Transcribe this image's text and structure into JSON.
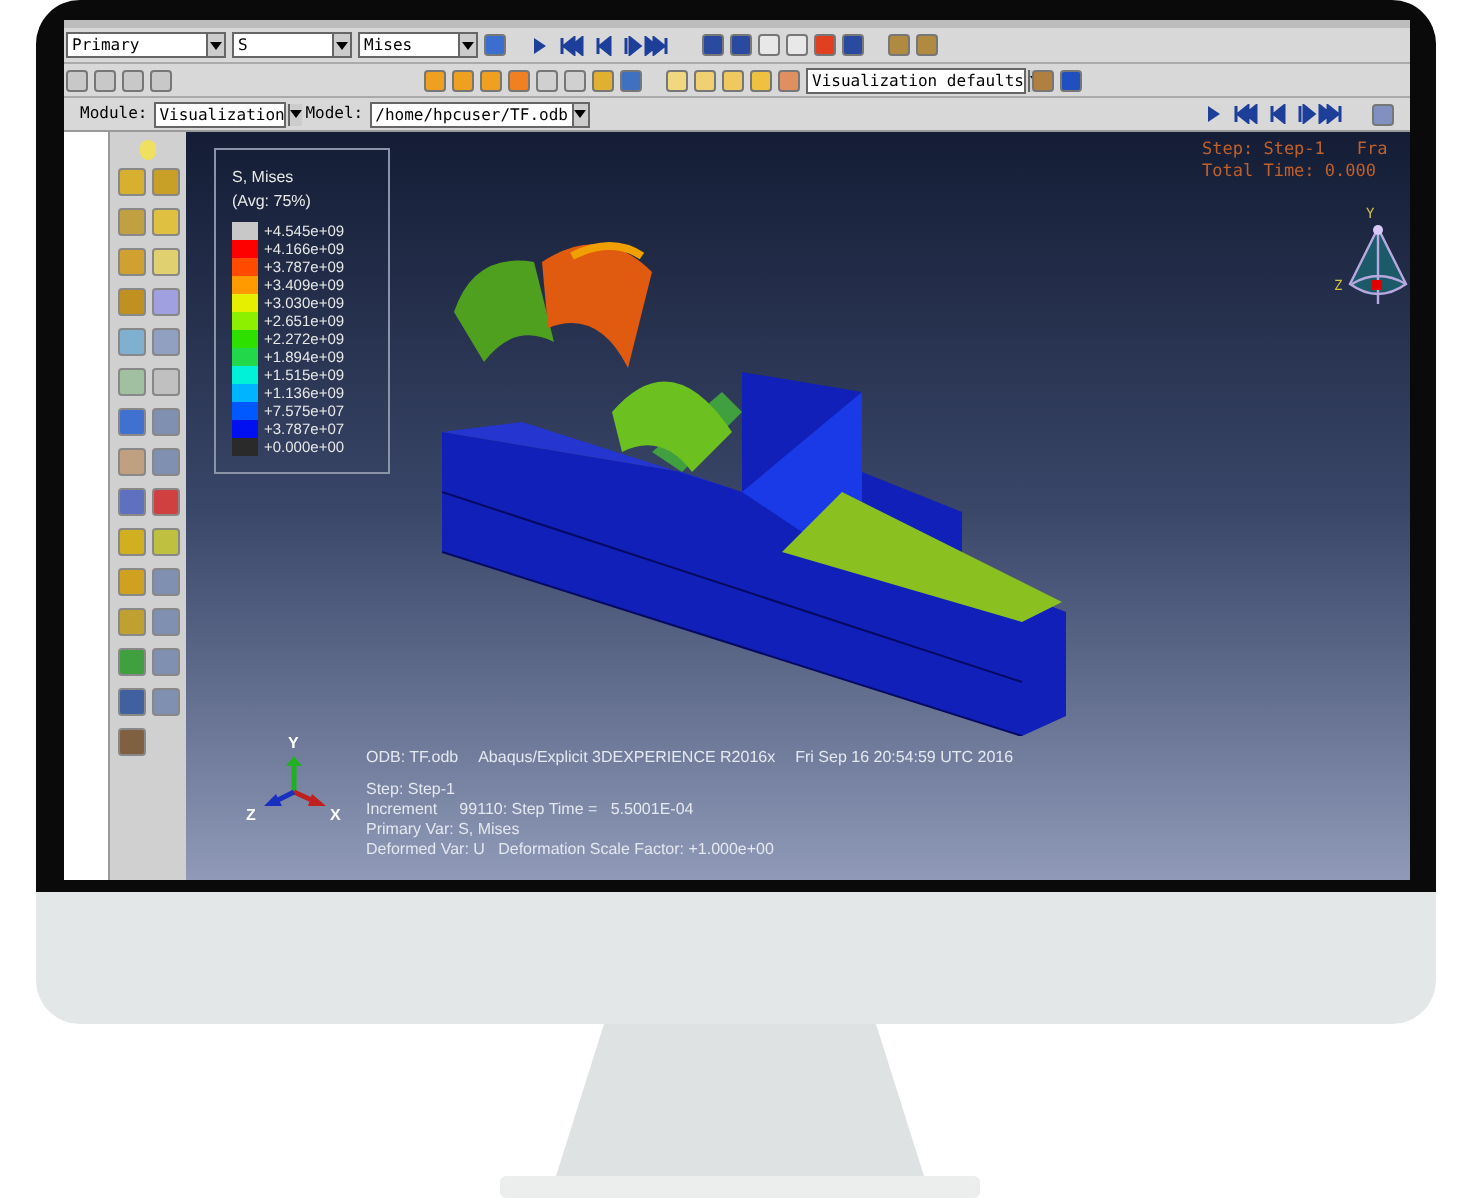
{
  "toolbar": {
    "field_output": [
      "Primary",
      "S",
      "Mises"
    ],
    "view_style": "Visualization defaults"
  },
  "context_bar": {
    "module_label": "Module:",
    "module": "Visualization",
    "model_label": "Model:",
    "model": "/home/hpcuser/TF.odb"
  },
  "legend": {
    "title": "S, Mises",
    "subtitle": "(Avg: 75%)",
    "entries": [
      {
        "value": "+4.545e+09",
        "color": "#c8c8c8"
      },
      {
        "value": "+4.166e+09",
        "color": "#ff0000"
      },
      {
        "value": "+3.787e+09",
        "color": "#ff4a00"
      },
      {
        "value": "+3.409e+09",
        "color": "#ff9a00"
      },
      {
        "value": "+3.030e+09",
        "color": "#e6ef00"
      },
      {
        "value": "+2.651e+09",
        "color": "#8cf000"
      },
      {
        "value": "+2.272e+09",
        "color": "#2ee000"
      },
      {
        "value": "+1.894e+09",
        "color": "#22d84a"
      },
      {
        "value": "+1.515e+09",
        "color": "#00f0d8"
      },
      {
        "value": "+1.136e+09",
        "color": "#00b4ff"
      },
      {
        "value": "+7.575e+07",
        "color": "#0058ff"
      },
      {
        "value": "+3.787e+07",
        "color": "#0010f0"
      },
      {
        "value": "+0.000e+00",
        "color": "#2a2a2a"
      }
    ]
  },
  "step_info": [
    "Step: Step-1",
    "Fra",
    "Total Time: 0.000"
  ],
  "orientation_triad": {
    "y": "Y",
    "z": "Z"
  },
  "axis_triad": {
    "y": "Y",
    "z": "Z",
    "x": "X"
  },
  "info": {
    "odb": "ODB: TF.odb",
    "solver": "Abaqus/Explicit 3DEXPERIENCE R2016x",
    "date": "Fri Sep 16 20:54:59 UTC 2016",
    "lines": [
      "Step: Step-1",
      "Increment     99110: Step Time =   5.5001E-04",
      "Primary Var: S, Mises",
      "Deformed Var: U   Deformation Scale Factor: +1.000e+00"
    ]
  }
}
